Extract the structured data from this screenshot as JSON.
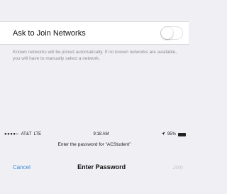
{
  "settings": {
    "ask_to_join_label": "Ask to Join Networks",
    "ask_to_join_enabled": false,
    "footer_note": "Known networks will be joined automatically. If no known networks are available, you will have to manually select a network."
  },
  "status_bar": {
    "signal": "●●●●○",
    "carrier": "AT&T",
    "network": "LTE",
    "time": "9:18 AM",
    "battery": "95%",
    "battery_level": 0.95
  },
  "password_dialog": {
    "prompt": "Enter the password for “ACStudent”",
    "cancel_label": "Cancel",
    "title": "Enter Password",
    "join_label": "Join"
  }
}
